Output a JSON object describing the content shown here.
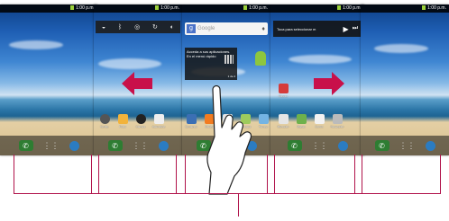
{
  "status": {
    "time": "1:00 p.m."
  },
  "panels": [
    {
      "id": "p1",
      "apps": []
    },
    {
      "id": "p2",
      "apps": [
        "Config.",
        "Fotos",
        "Cámara",
        "Calendario"
      ]
    },
    {
      "id": "p3",
      "search_placeholder": "Google",
      "widget_text": "Acceda a sus aplicaciones.",
      "widget_subtext": "En el menú rápido",
      "widget_page": "1 de 4",
      "apps": [
        "Contactos",
        "Música",
        "Marcador",
        "Mensajes",
        "Tiempo",
        "Calculadora",
        "Navegador"
      ]
    },
    {
      "id": "p4",
      "player_text": "Toca para seleccionar m",
      "apps": [
        "Fitness",
        "Marcador",
        "Mapas",
        "Correo",
        "Navegador"
      ]
    },
    {
      "id": "p5",
      "apps": []
    }
  ],
  "arrows": [
    {
      "direction": "left",
      "color": "#c8104a"
    },
    {
      "direction": "right",
      "color": "#c8104a"
    }
  ],
  "callout_color": "#b0124a",
  "icons": {
    "phone": "phone-icon",
    "grid": "app-grid-icon",
    "globe": "browser-icon"
  }
}
